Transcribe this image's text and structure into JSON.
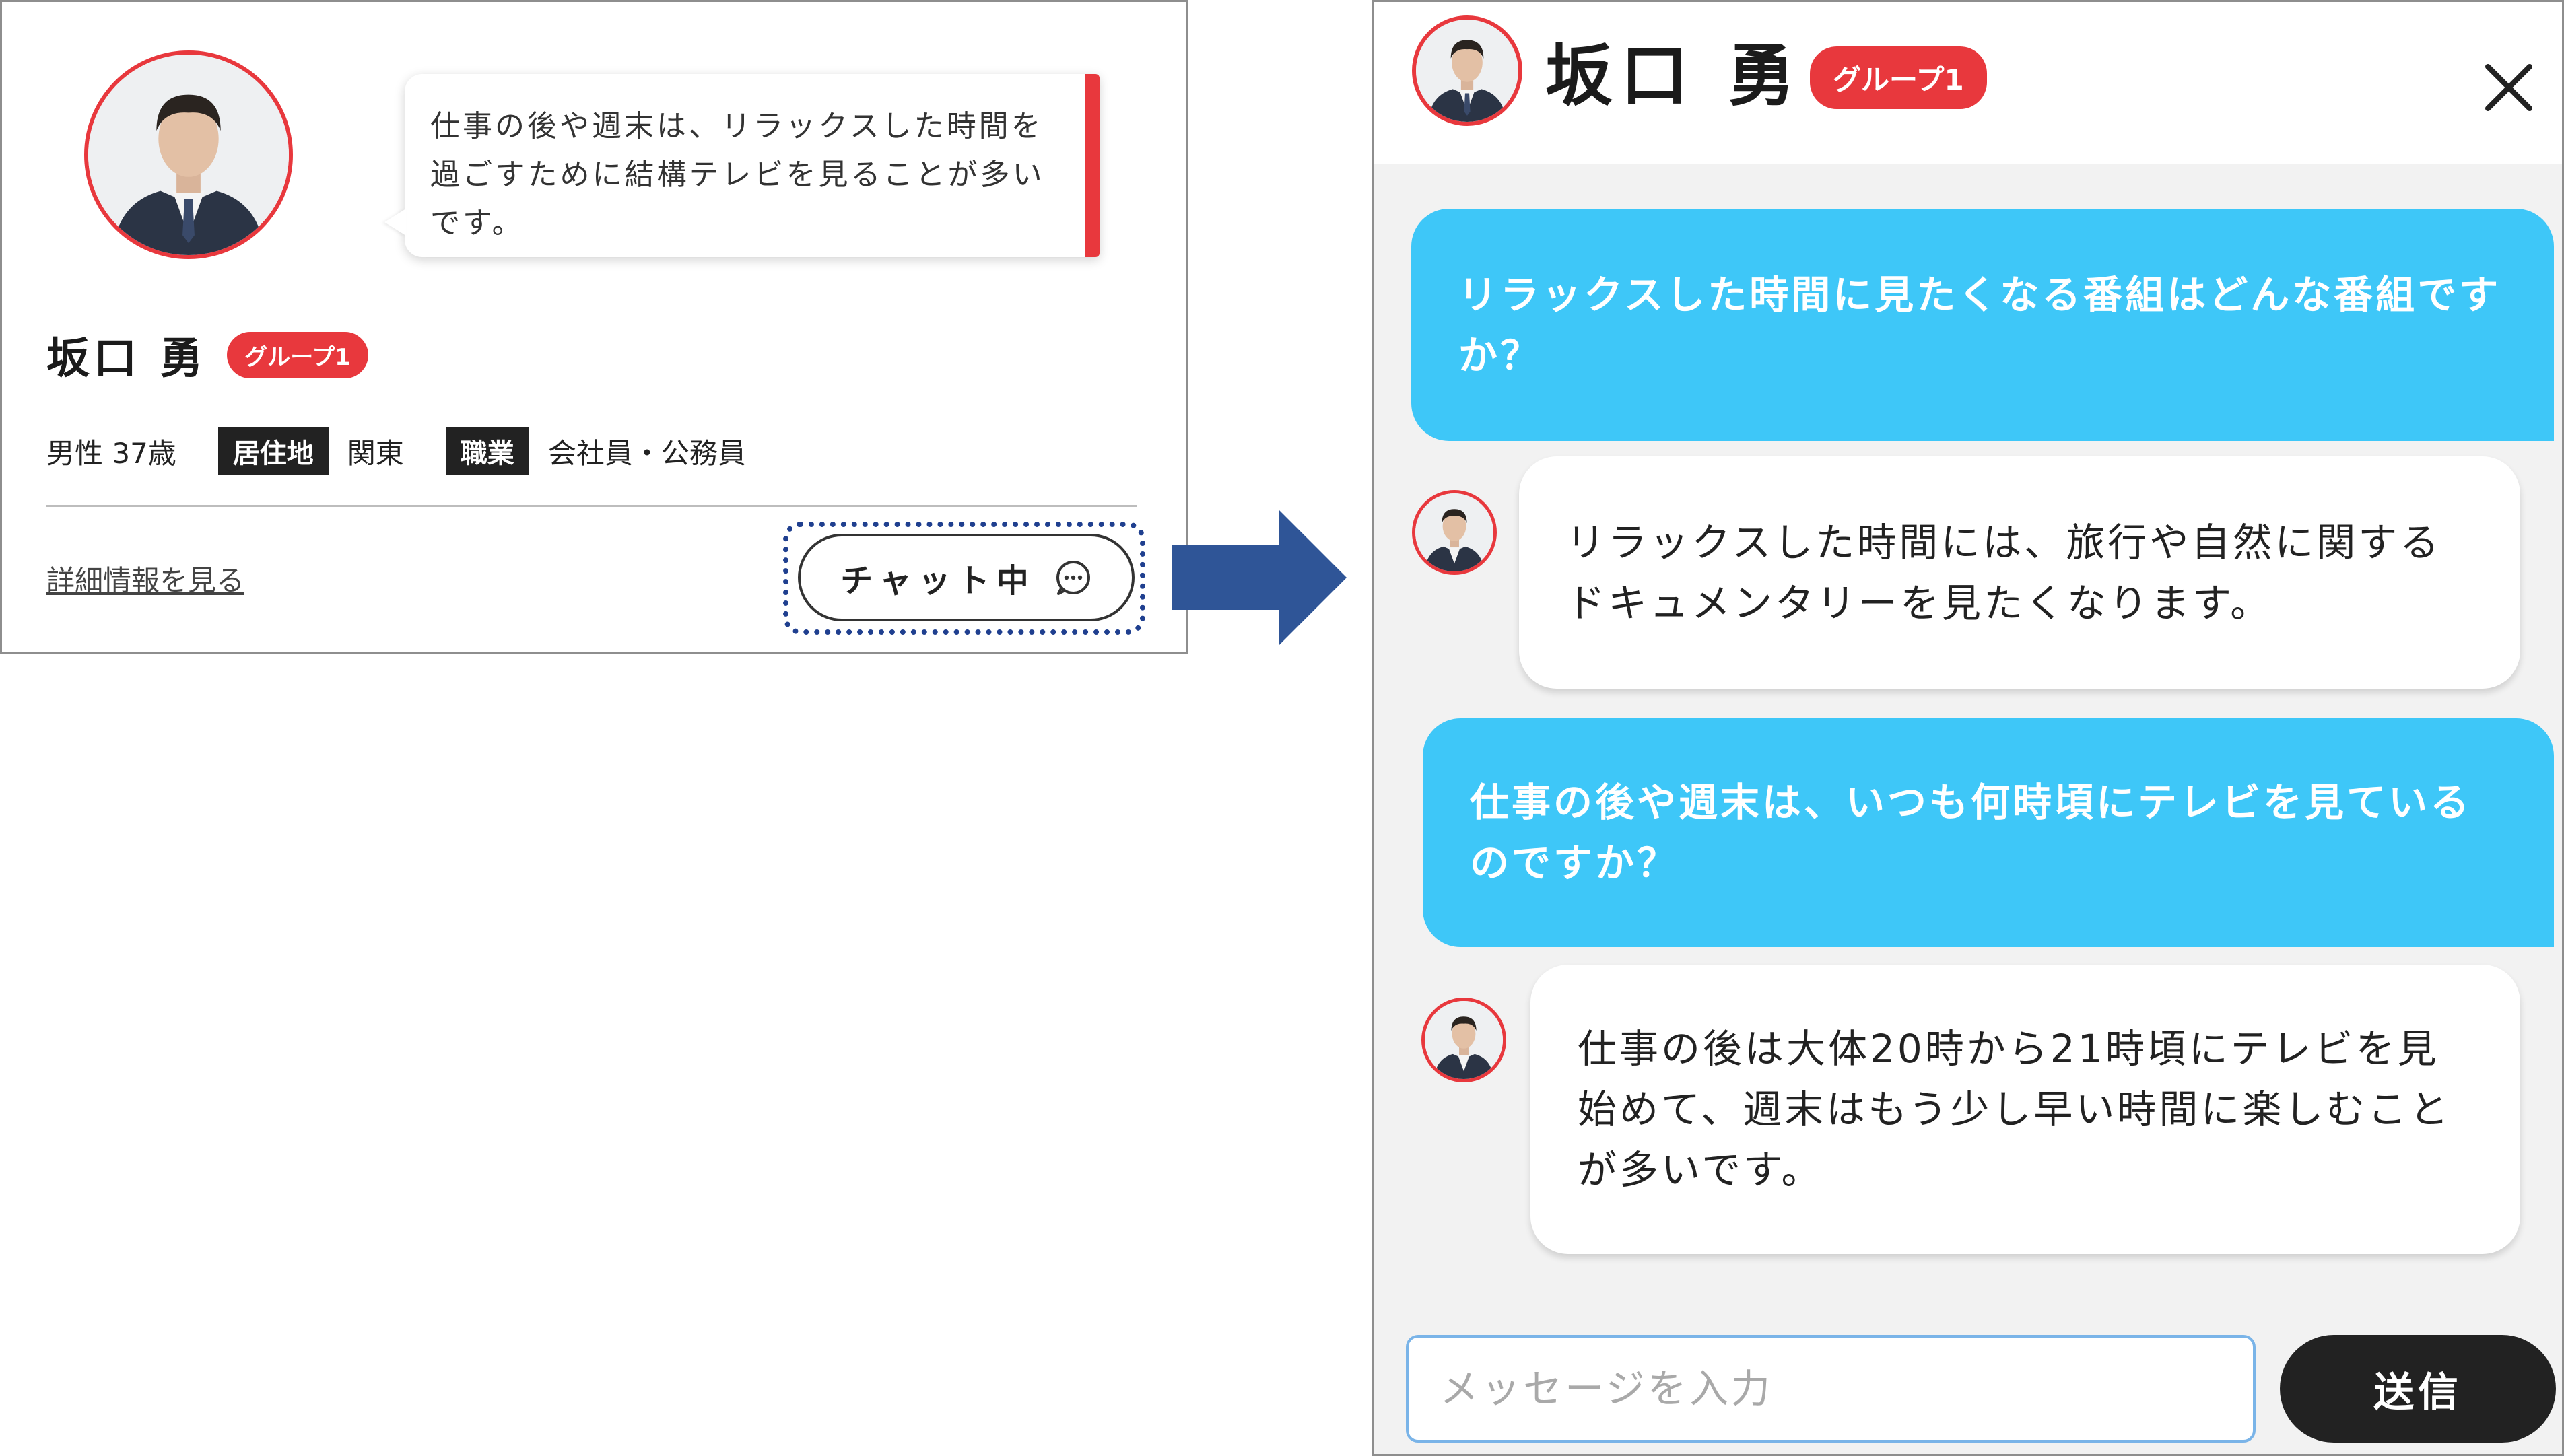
{
  "profile_card": {
    "bubble_text": "仕事の後や週末は、リラックスした時間を過ごすために結構テレビを見ることが多いです。",
    "name": "坂口 勇",
    "badge": "グループ1",
    "gender_age": "男性 37歳",
    "residence_label": "居住地",
    "residence_value": "関東",
    "occupation_label": "職業",
    "occupation_value": "会社員・公務員",
    "detail_link": "詳細情報を見る",
    "chat_button": "チャット中"
  },
  "chat_window": {
    "name": "坂口 勇",
    "badge": "グループ1",
    "messages": [
      {
        "role": "question",
        "text": "リラックスした時間に見たくなる番組はどんな番組ですか？"
      },
      {
        "role": "answer",
        "text": "リラックスした時間には、旅行や自然に関するドキュメンタリーを見たくなります。"
      },
      {
        "role": "question",
        "text": "仕事の後や週末は、いつも何時頃にテレビを見ているのですか？"
      },
      {
        "role": "answer",
        "text": "仕事の後は大体20時から21時頃にテレビを見始めて、週末はもう少し早い時間に楽しむことが多いです。"
      }
    ],
    "input_placeholder": "メッセージを入力",
    "send_label": "送信"
  },
  "colors": {
    "accent_red": "#e8383d",
    "question_blue": "#3ec7f8",
    "arrow_blue": "#2f5597",
    "focus_blue": "#1f3f8f"
  },
  "icons": {
    "chat_button": "chat-bubble-dots-icon",
    "close": "close-icon",
    "arrow": "right-arrow-icon"
  }
}
